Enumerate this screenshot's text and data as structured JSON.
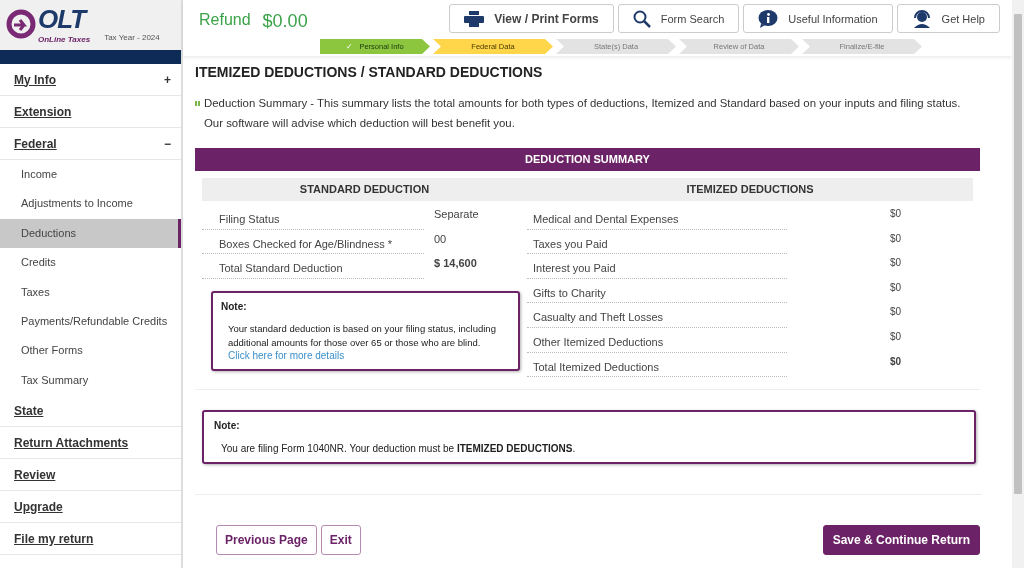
{
  "logo": {
    "name": "OLT",
    "tagline": "OnLine Taxes",
    "tax_year": "Tax Year - 2024"
  },
  "sidebar": {
    "items": [
      {
        "label": "My Info",
        "toggle": "+"
      },
      {
        "label": "Extension"
      },
      {
        "label": "Federal",
        "toggle": "−",
        "children": [
          {
            "label": "Income",
            "selected": false
          },
          {
            "label": "Adjustments to Income",
            "selected": false
          },
          {
            "label": "Deductions",
            "selected": true
          },
          {
            "label": "Credits",
            "selected": false
          },
          {
            "label": "Taxes",
            "selected": false
          },
          {
            "label": "Payments/Refundable Credits",
            "selected": false
          },
          {
            "label": "Other Forms",
            "selected": false
          },
          {
            "label": "Tax Summary",
            "selected": false
          }
        ]
      },
      {
        "label": "State"
      },
      {
        "label": "Return Attachments"
      },
      {
        "label": "Review"
      },
      {
        "label": "Upgrade"
      },
      {
        "label": "File my return"
      }
    ]
  },
  "refund": {
    "label": "Refund",
    "amount": "$0.00"
  },
  "toolbar": [
    {
      "kind": "print",
      "label": "View / Print Forms"
    },
    {
      "kind": "search",
      "label": "Form Search"
    },
    {
      "kind": "info",
      "label": "Useful Information"
    },
    {
      "kind": "help",
      "label": "Get Help"
    }
  ],
  "steps": [
    {
      "label": "Personal Info",
      "kind": "done",
      "check": "✓"
    },
    {
      "label": "Federal Data",
      "kind": "current"
    },
    {
      "label": "State(s) Data",
      "kind": "pending"
    },
    {
      "label": "Review of Data",
      "kind": "pending"
    },
    {
      "label": "Finalize/E-file",
      "kind": "pending"
    }
  ],
  "page_title": "ITEMIZED DEDUCTIONS / STANDARD DEDUCTIONS",
  "description": "Deduction Summary - This summary lists the total amounts for both types of deductions, Itemized and Standard based on your inputs and filing status. Our software will advise which deduction will best benefit you.",
  "summary": {
    "title": "DEDUCTION SUMMARY",
    "standard": {
      "heading": "STANDARD DEDUCTION",
      "rows": [
        {
          "label": "Filing Status",
          "value": "Separate",
          "total": false
        },
        {
          "label": "Boxes Checked for Age/Blindness *",
          "value": "00",
          "total": false
        },
        {
          "label": "Total Standard Deduction",
          "value": "$ 14,600",
          "total": true
        }
      ],
      "note": {
        "title": "Note:",
        "text": "Your standard deduction is based on your filing status, including additional amounts for those over 65 or those who are blind.",
        "link": "Click here for more details"
      }
    },
    "itemized": {
      "heading": "ITEMIZED DEDUCTIONS",
      "rows": [
        {
          "label": "Medical and Dental Expenses",
          "value": "$0",
          "total": false
        },
        {
          "label": "Taxes you Paid",
          "value": "$0",
          "total": false
        },
        {
          "label": "Interest you Paid",
          "value": "$0",
          "total": false
        },
        {
          "label": "Gifts to Charity",
          "value": "$0",
          "total": false
        },
        {
          "label": "Casualty and Theft Losses",
          "value": "$0",
          "total": false
        },
        {
          "label": "Other Itemized Deductions",
          "value": "$0",
          "total": false
        },
        {
          "label": "Total Itemized Deductions",
          "value": "$0",
          "total": true
        }
      ]
    }
  },
  "bottom_note": {
    "title": "Note:",
    "text": "You are filing Form 1040NR. Your deduction must be **ITEMIZED DEDUCTIONS**."
  },
  "buttons": [
    {
      "kind": "secondary",
      "label": "Previous Page"
    },
    {
      "kind": "secondary",
      "label": "Exit"
    },
    {
      "kind": "primary",
      "label": "Save & Continue Return"
    }
  ]
}
